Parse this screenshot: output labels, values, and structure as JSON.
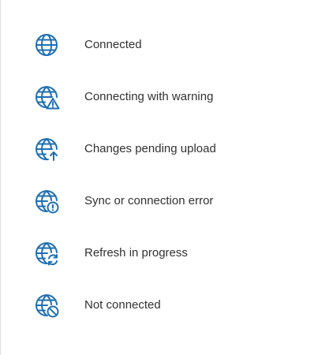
{
  "colors": {
    "icon": "#1f6fb2",
    "text": "#323130",
    "background": "#ffffff",
    "border": "#e1e1e1"
  },
  "status_list": {
    "items": [
      {
        "label": "Connected",
        "icon": "globe-icon"
      },
      {
        "label": "Connecting with warning",
        "icon": "globe-warning-icon"
      },
      {
        "label": "Changes pending upload",
        "icon": "globe-upload-icon"
      },
      {
        "label": "Sync or connection error",
        "icon": "globe-error-icon"
      },
      {
        "label": "Refresh in progress",
        "icon": "globe-refresh-icon"
      },
      {
        "label": "Not connected",
        "icon": "globe-blocked-icon"
      }
    ]
  }
}
